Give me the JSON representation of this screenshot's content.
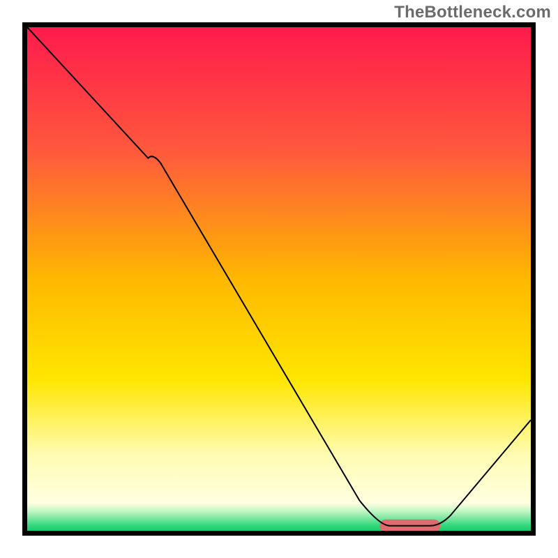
{
  "watermark": "TheBottleneck.com",
  "chart_data": {
    "type": "line",
    "title": "",
    "xlabel": "",
    "ylabel": "",
    "xlim": [
      0,
      100
    ],
    "ylim": [
      0,
      100
    ],
    "grid": false,
    "series": [
      {
        "name": "curve",
        "x": [
          0,
          25,
          70,
          82,
          100
        ],
        "y": [
          100,
          75,
          1,
          1,
          22
        ],
        "color": "#000000",
        "stroke_width": 2
      }
    ],
    "markers": [
      {
        "name": "optimal-marker",
        "x_start": 70,
        "x_end": 82,
        "y": 1,
        "color": "#e26a6e",
        "height": 2.5
      }
    ],
    "background_gradient": {
      "stops": [
        {
          "offset": 0.0,
          "color": "#ff1a4d"
        },
        {
          "offset": 0.25,
          "color": "#ff5a3c"
        },
        {
          "offset": 0.5,
          "color": "#ffb800"
        },
        {
          "offset": 0.7,
          "color": "#ffe600"
        },
        {
          "offset": 0.85,
          "color": "#fffcb3"
        },
        {
          "offset": 0.945,
          "color": "#ffffe0"
        },
        {
          "offset": 0.96,
          "color": "#c6f7c6"
        },
        {
          "offset": 0.99,
          "color": "#2fd87a"
        },
        {
          "offset": 1.0,
          "color": "#18c96b"
        }
      ]
    }
  }
}
